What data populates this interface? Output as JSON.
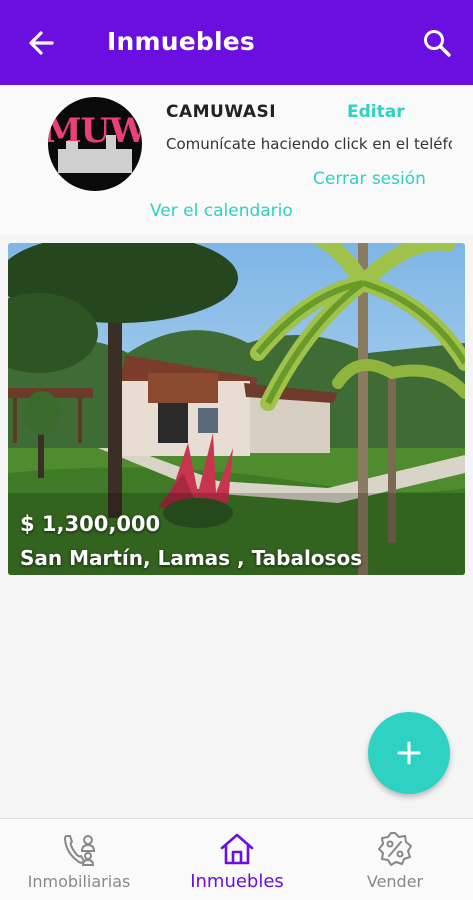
{
  "header": {
    "title": "Inmuebles",
    "back_icon": "arrow-left-icon",
    "search_icon": "search-icon",
    "color": "#6a0fe0"
  },
  "profile": {
    "logo_text": "MUW",
    "name": "CAMUWASI",
    "edit_label": "Editar",
    "description": "Comunícate haciendo click en el teléfono",
    "logout_label": "Cerrar sesión",
    "calendar_label": "Ver el calendario",
    "accent": "#2ed1c2"
  },
  "listings": [
    {
      "price": "$ 1,300,000",
      "location": "San Martín, Lamas , Tabalosos"
    }
  ],
  "fab": {
    "icon": "plus-icon"
  },
  "bottom_nav": {
    "items": [
      {
        "label": "Inmobiliarias",
        "icon": "agency-contact-icon",
        "active": false
      },
      {
        "label": "Inmuebles",
        "icon": "house-icon",
        "active": true
      },
      {
        "label": "Vender",
        "icon": "percent-badge-icon",
        "active": false
      }
    ]
  }
}
